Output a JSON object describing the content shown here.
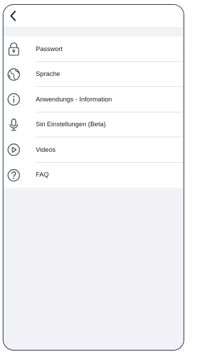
{
  "nav": {
    "back_icon": "chevron-left-icon"
  },
  "menu": {
    "items": [
      {
        "label": "Passwort",
        "icon": "lock-icon"
      },
      {
        "label": "Sprache",
        "icon": "globe-icon"
      },
      {
        "label": "Anwendungs - Information",
        "icon": "info-icon"
      },
      {
        "label": "Siri Einstellungen (Beta)",
        "icon": "microphone-icon"
      },
      {
        "label": "Videos",
        "icon": "play-icon"
      },
      {
        "label": "FAQ",
        "icon": "question-icon"
      }
    ]
  },
  "colors": {
    "frame_border": "#1f3a5a",
    "background": "#f2f2f6",
    "list_background": "#ffffff",
    "divider": "#e2e2e6",
    "text": "#1a1a1a",
    "icon_stroke": "#333333"
  }
}
